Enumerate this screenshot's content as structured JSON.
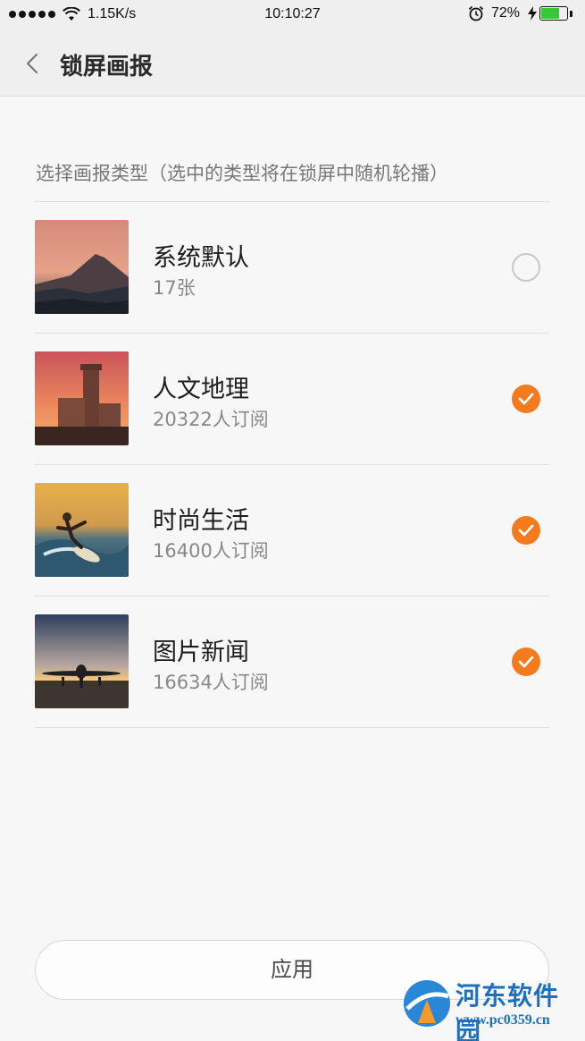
{
  "status_bar": {
    "net_speed": "1.15K/s",
    "time": "10:10:27",
    "battery": "72%",
    "battery_level": 0.72
  },
  "header": {
    "back_icon": "chevron-left-icon",
    "title": "锁屏画报"
  },
  "section_label": "选择画报类型（选中的类型将在锁屏中随机轮播）",
  "items": [
    {
      "title": "系统默认",
      "subtitle": "17张",
      "checked": false,
      "thumb": "mountain-sunset"
    },
    {
      "title": "人文地理",
      "subtitle": "20322人订阅",
      "checked": true,
      "thumb": "castle-tower"
    },
    {
      "title": "时尚生活",
      "subtitle": "16400人订阅",
      "checked": true,
      "thumb": "surfer-wave"
    },
    {
      "title": "图片新闻",
      "subtitle": "16634人订阅",
      "checked": true,
      "thumb": "airplane-runway"
    }
  ],
  "apply_button": "应用",
  "watermark": {
    "name": "河东软件园",
    "url": "www.pc0359.cn"
  },
  "colors": {
    "accent": "#f37b1d",
    "background": "#f7f7f7",
    "header_bg": "#efefef"
  }
}
